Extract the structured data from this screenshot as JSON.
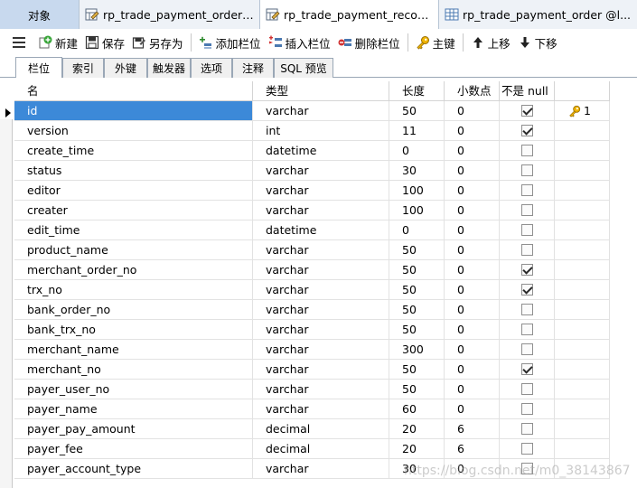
{
  "doc_tabs": [
    {
      "label": "对象",
      "icon": "object-tab"
    },
    {
      "label": "rp_trade_payment_order @l...",
      "icon": "table-design-icon"
    },
    {
      "label": "rp_trade_payment_record ...",
      "icon": "table-design-icon"
    },
    {
      "label": "rp_trade_payment_order @l...",
      "icon": "table-grid-icon"
    }
  ],
  "toolbar": {
    "new_label": "新建",
    "save_label": "保存",
    "save_as_label": "另存为",
    "add_field_label": "添加栏位",
    "insert_field_label": "插入栏位",
    "delete_field_label": "删除栏位",
    "primary_key_label": "主键",
    "move_up_label": "上移",
    "move_down_label": "下移"
  },
  "sub_tabs": [
    "栏位",
    "索引",
    "外键",
    "触发器",
    "选项",
    "注释",
    "SQL 预览"
  ],
  "columns": [
    "名",
    "类型",
    "长度",
    "小数点",
    "不是 null",
    ""
  ],
  "colors": {
    "selection": "#3c89d8",
    "key": "#e8a400"
  },
  "rows": [
    {
      "name": "id",
      "type": "varchar",
      "length": "50",
      "decimals": "0",
      "not_null": true,
      "key": "1"
    },
    {
      "name": "version",
      "type": "int",
      "length": "11",
      "decimals": "0",
      "not_null": true,
      "key": ""
    },
    {
      "name": "create_time",
      "type": "datetime",
      "length": "0",
      "decimals": "0",
      "not_null": false,
      "key": ""
    },
    {
      "name": "status",
      "type": "varchar",
      "length": "30",
      "decimals": "0",
      "not_null": false,
      "key": ""
    },
    {
      "name": "editor",
      "type": "varchar",
      "length": "100",
      "decimals": "0",
      "not_null": false,
      "key": ""
    },
    {
      "name": "creater",
      "type": "varchar",
      "length": "100",
      "decimals": "0",
      "not_null": false,
      "key": ""
    },
    {
      "name": "edit_time",
      "type": "datetime",
      "length": "0",
      "decimals": "0",
      "not_null": false,
      "key": ""
    },
    {
      "name": "product_name",
      "type": "varchar",
      "length": "50",
      "decimals": "0",
      "not_null": false,
      "key": ""
    },
    {
      "name": "merchant_order_no",
      "type": "varchar",
      "length": "50",
      "decimals": "0",
      "not_null": true,
      "key": ""
    },
    {
      "name": "trx_no",
      "type": "varchar",
      "length": "50",
      "decimals": "0",
      "not_null": true,
      "key": ""
    },
    {
      "name": "bank_order_no",
      "type": "varchar",
      "length": "50",
      "decimals": "0",
      "not_null": false,
      "key": ""
    },
    {
      "name": "bank_trx_no",
      "type": "varchar",
      "length": "50",
      "decimals": "0",
      "not_null": false,
      "key": ""
    },
    {
      "name": "merchant_name",
      "type": "varchar",
      "length": "300",
      "decimals": "0",
      "not_null": false,
      "key": ""
    },
    {
      "name": "merchant_no",
      "type": "varchar",
      "length": "50",
      "decimals": "0",
      "not_null": true,
      "key": ""
    },
    {
      "name": "payer_user_no",
      "type": "varchar",
      "length": "50",
      "decimals": "0",
      "not_null": false,
      "key": ""
    },
    {
      "name": "payer_name",
      "type": "varchar",
      "length": "60",
      "decimals": "0",
      "not_null": false,
      "key": ""
    },
    {
      "name": "payer_pay_amount",
      "type": "decimal",
      "length": "20",
      "decimals": "6",
      "not_null": false,
      "key": ""
    },
    {
      "name": "payer_fee",
      "type": "decimal",
      "length": "20",
      "decimals": "6",
      "not_null": false,
      "key": ""
    },
    {
      "name": "payer_account_type",
      "type": "varchar",
      "length": "30",
      "decimals": "0",
      "not_null": false,
      "key": ""
    }
  ],
  "watermark": "https://blog.csdn.net/m0_38143867"
}
